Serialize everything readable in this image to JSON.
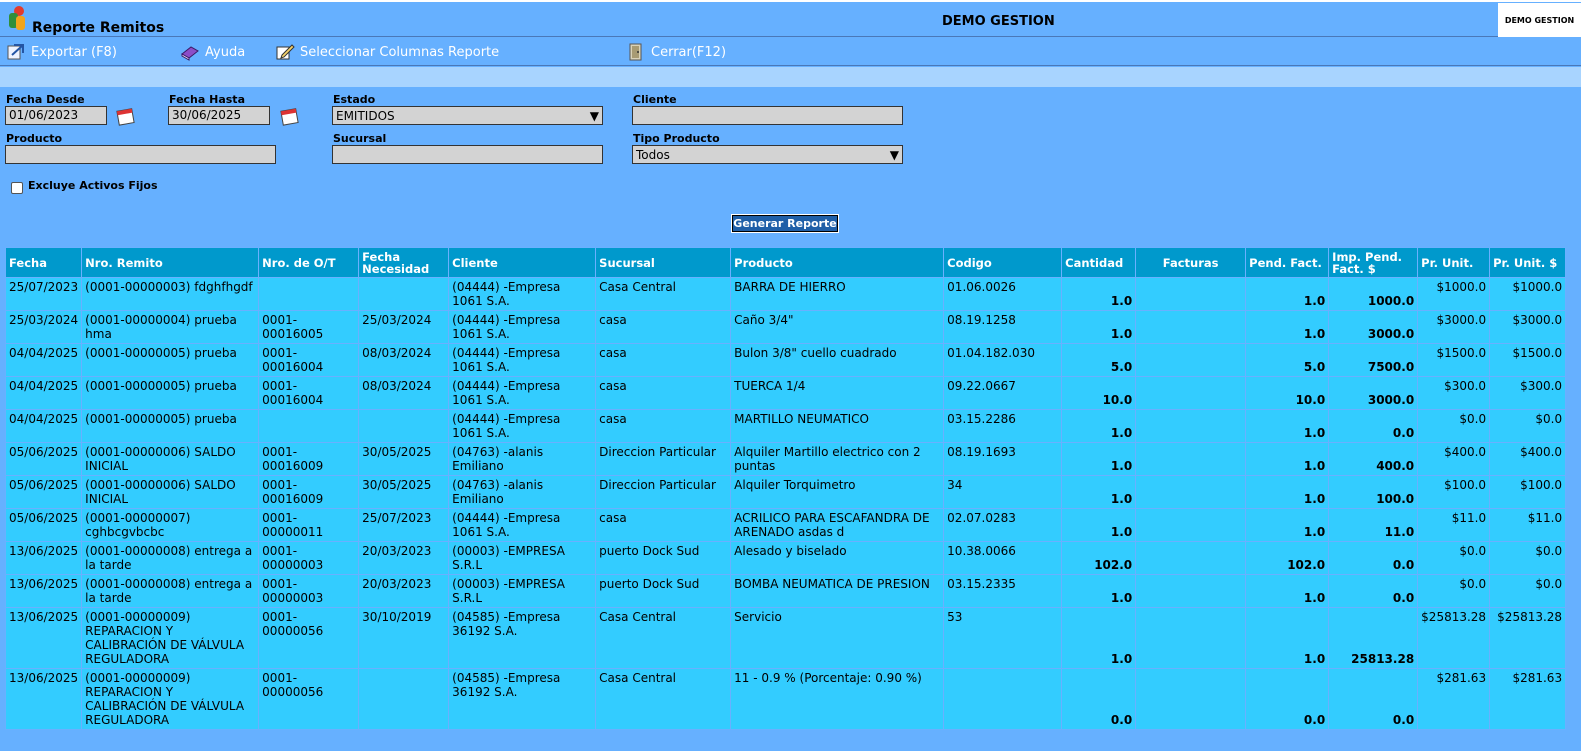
{
  "window": {
    "title": "Reporte Remitos",
    "company": "DEMO GESTION",
    "brand": "DEMO GESTION"
  },
  "menu": {
    "exportar": "Exportar (F8)",
    "ayuda": "Ayuda",
    "seleccionar": "Seleccionar Columnas Reporte",
    "cerrar": "Cerrar(F12)"
  },
  "filters": {
    "fecha_desde_label": "Fecha Desde",
    "fecha_desde_value": "01/06/2023",
    "fecha_hasta_label": "Fecha Hasta",
    "fecha_hasta_value": "30/06/2025",
    "estado_label": "Estado",
    "estado_value": "EMITIDOS",
    "cliente_label": "Cliente",
    "cliente_value": "",
    "producto_label": "Producto",
    "producto_value": "",
    "sucursal_label": "Sucursal",
    "sucursal_value": "",
    "tipo_label": "Tipo Producto",
    "tipo_value": "Todos",
    "excluye_label": "Excluye Activos Fijos",
    "excluye_checked": false,
    "generar_label": "Generar Reporte"
  },
  "table": {
    "headers": [
      "Fecha",
      "Nro. Remito",
      "Nro. de O/T",
      "Fecha Necesidad",
      "Cliente",
      "Sucursal",
      "Producto",
      "Codigo",
      "Cantidad",
      "Facturas",
      "Pend. Fact.",
      "Imp. Pend. Fact. $",
      "Pr. Unit.",
      "Pr. Unit. $"
    ],
    "rows": [
      [
        "25/07/2023",
        "(0001-00000003) fdghfhgdf",
        "",
        "",
        "(04444) -Empresa 1061 S.A.",
        "Casa Central",
        "BARRA DE HIERRO",
        "01.06.0026",
        "1.0",
        "",
        "1.0",
        "1000.0",
        "$1000.0",
        "$1000.0"
      ],
      [
        "25/03/2024",
        "(0001-00000004) prueba hma",
        "0001-00016005",
        "25/03/2024",
        "(04444) -Empresa 1061 S.A.",
        "casa",
        "Caño 3/4\"",
        "08.19.1258",
        "1.0",
        "",
        "1.0",
        "3000.0",
        "$3000.0",
        "$3000.0"
      ],
      [
        "04/04/2025",
        "(0001-00000005) prueba",
        "0001-00016004",
        "08/03/2024",
        "(04444) -Empresa 1061 S.A.",
        "casa",
        "Bulon 3/8\" cuello cuadrado",
        "01.04.182.030",
        "5.0",
        "",
        "5.0",
        "7500.0",
        "$1500.0",
        "$1500.0"
      ],
      [
        "04/04/2025",
        "(0001-00000005) prueba",
        "0001-00016004",
        "08/03/2024",
        "(04444) -Empresa 1061 S.A.",
        "casa",
        "TUERCA 1/4",
        "09.22.0667",
        "10.0",
        "",
        "10.0",
        "3000.0",
        "$300.0",
        "$300.0"
      ],
      [
        "04/04/2025",
        "(0001-00000005) prueba",
        "",
        "",
        "(04444) -Empresa 1061 S.A.",
        "casa",
        "MARTILLO NEUMATICO",
        "03.15.2286",
        "1.0",
        "",
        "1.0",
        "0.0",
        "$0.0",
        "$0.0"
      ],
      [
        "05/06/2025",
        "(0001-00000006) SALDO INICIAL",
        "0001-00016009",
        "30/05/2025",
        "(04763) -alanis Emiliano",
        "Direccion Particular",
        "Alquiler Martillo electrico con 2 puntas",
        "08.19.1693",
        "1.0",
        "",
        "1.0",
        "400.0",
        "$400.0",
        "$400.0"
      ],
      [
        "05/06/2025",
        "(0001-00000006) SALDO INICIAL",
        "0001-00016009",
        "30/05/2025",
        "(04763) -alanis Emiliano",
        "Direccion Particular",
        "Alquiler Torquimetro",
        "34",
        "1.0",
        "",
        "1.0",
        "100.0",
        "$100.0",
        "$100.0"
      ],
      [
        "05/06/2025",
        "(0001-00000007) cghbcgvbcbc",
        "0001-00000011",
        "25/07/2023",
        "(04444) -Empresa 1061 S.A.",
        "casa",
        "ACRILICO PARA ESCAFANDRA DE ARENADO asdas d",
        "02.07.0283",
        "1.0",
        "",
        "1.0",
        "11.0",
        "$11.0",
        "$11.0"
      ],
      [
        "13/06/2025",
        "(0001-00000008) entrega a la tarde",
        "0001-00000003",
        "20/03/2023",
        "(00003) -EMPRESA S.R.L",
        "puerto Dock Sud",
        "Alesado y biselado",
        "10.38.0066",
        "102.0",
        "",
        "102.0",
        "0.0",
        "$0.0",
        "$0.0"
      ],
      [
        "13/06/2025",
        "(0001-00000008) entrega a la tarde",
        "0001-00000003",
        "20/03/2023",
        "(00003) -EMPRESA S.R.L",
        "puerto Dock Sud",
        "BOMBA NEUMATICA DE PRESION",
        "03.15.2335",
        "1.0",
        "",
        "1.0",
        "0.0",
        "$0.0",
        "$0.0"
      ],
      [
        "13/06/2025",
        "(0001-00000009) REPARACION Y CALIBRACIÓN DE VÁLVULA REGULADORA",
        "0001-00000056",
        "30/10/2019",
        "(04585) -Empresa 36192 S.A.",
        "Casa Central",
        "Servicio",
        "53",
        "1.0",
        "",
        "1.0",
        "25813.28",
        "$25813.28",
        "$25813.28"
      ],
      [
        "13/06/2025",
        "(0001-00000009) REPARACION Y CALIBRACIÓN DE VÁLVULA REGULADORA",
        "0001-00000056",
        "",
        "(04585) -Empresa 36192 S.A.",
        "Casa Central",
        "11 - 0.9 % (Porcentaje: 0.90 %)",
        "",
        "0.0",
        "",
        "0.0",
        "0.0",
        "$281.63",
        "$281.63"
      ]
    ]
  },
  "icons": {
    "logo": "app-logo-icon",
    "exportar": "export-icon",
    "ayuda": "help-book-icon",
    "seleccionar": "edit-columns-icon",
    "cerrar": "close-door-icon",
    "calendar": "calendar-icon"
  },
  "colors": {
    "background": "#66b0ff",
    "table_header": "#0099cc",
    "table_cell": "#33ccff",
    "button": "#1f5fa8"
  }
}
